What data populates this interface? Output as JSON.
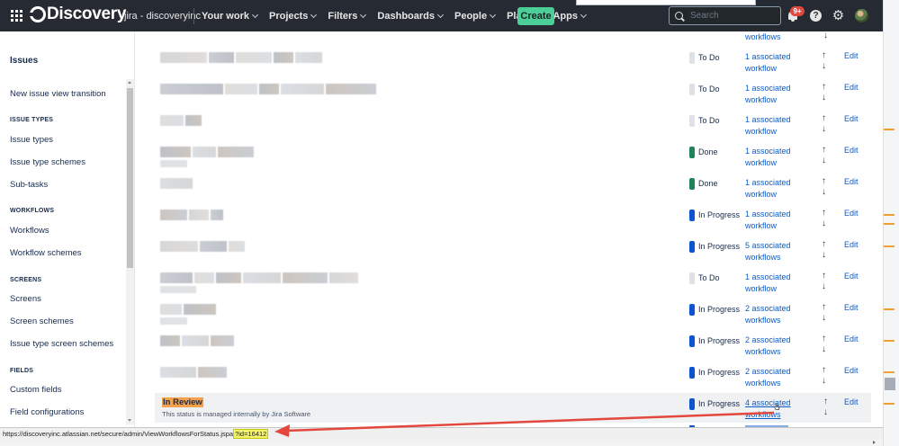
{
  "topnav": {
    "brand": "Discovery",
    "site": "jira - discoveryinc",
    "items": [
      "Your work",
      "Projects",
      "Filters",
      "Dashboards",
      "People",
      "Plans",
      "Apps"
    ],
    "create_label": "Create",
    "search_placeholder": "Search",
    "notifications_badge": "9+",
    "help_label": "?"
  },
  "sidebar": {
    "heading": "Issues",
    "top_link": "New issue view transition",
    "sections": [
      {
        "title": "ISSUE TYPES",
        "links": [
          "Issue types",
          "Issue type schemes",
          "Sub-tasks"
        ]
      },
      {
        "title": "WORKFLOWS",
        "links": [
          "Workflows",
          "Workflow schemes"
        ]
      },
      {
        "title": "SCREENS",
        "links": [
          "Screens",
          "Screen schemes",
          "Issue type screen schemes"
        ]
      },
      {
        "title": "FIELDS",
        "links": [
          "Custom fields",
          "Field configurations"
        ]
      }
    ]
  },
  "table": {
    "top_partial_link": "workflows",
    "rows": [
      {
        "status": "To Do",
        "category": "todo",
        "workflows_line1": "1 associated",
        "workflows_line2": "workflow",
        "edit": "Edit"
      },
      {
        "status": "To Do",
        "category": "todo",
        "workflows_line1": "1 associated",
        "workflows_line2": "workflow",
        "edit": "Edit"
      },
      {
        "status": "To Do",
        "category": "todo",
        "workflows_line1": "1 associated",
        "workflows_line2": "workflow",
        "edit": "Edit"
      },
      {
        "status": "Done",
        "category": "done",
        "workflows_line1": "1 associated",
        "workflows_line2": "workflow",
        "edit": "Edit"
      },
      {
        "status": "Done",
        "category": "done",
        "workflows_line1": "1 associated",
        "workflows_line2": "workflow",
        "edit": "Edit"
      },
      {
        "status": "In Progress",
        "category": "inprogress",
        "workflows_line1": "1 associated",
        "workflows_line2": "workflow",
        "edit": "Edit"
      },
      {
        "status": "In Progress",
        "category": "inprogress",
        "workflows_line1": "5 associated",
        "workflows_line2": "workflows",
        "edit": "Edit"
      },
      {
        "status": "To Do",
        "category": "todo",
        "workflows_line1": "1 associated",
        "workflows_line2": "workflow",
        "edit": "Edit"
      },
      {
        "status": "In Progress",
        "category": "inprogress",
        "workflows_line1": "2 associated",
        "workflows_line2": "workflows",
        "edit": "Edit"
      },
      {
        "status": "In Progress",
        "category": "inprogress",
        "workflows_line1": "2 associated",
        "workflows_line2": "workflows",
        "edit": "Edit"
      },
      {
        "status": "In Progress",
        "category": "inprogress",
        "workflows_line1": "2 associated",
        "workflows_line2": "workflows",
        "edit": "Edit"
      }
    ],
    "review_row": {
      "name": "In Review",
      "description": "This status is managed internally by Jira Software",
      "status": "In Progress",
      "workflows_line1": "4 associated",
      "workflows_line2": "workflows",
      "edit": "Edit"
    }
  },
  "statusbar": {
    "url_prefix": "https://discoveryinc.atlassian.net/secure/admin/ViewWorkflowsForStatus.jspa",
    "url_query": "?id=16412"
  },
  "colors": {
    "todo": "#dfe1e6",
    "done": "#1f845a",
    "inprogress": "#0c55cf",
    "link": "#0c5cc8",
    "nav_bg": "#262b33",
    "create": "#4bce97",
    "annotation_arrow": "#e2483d",
    "query_highlight": "#f3f56a"
  }
}
